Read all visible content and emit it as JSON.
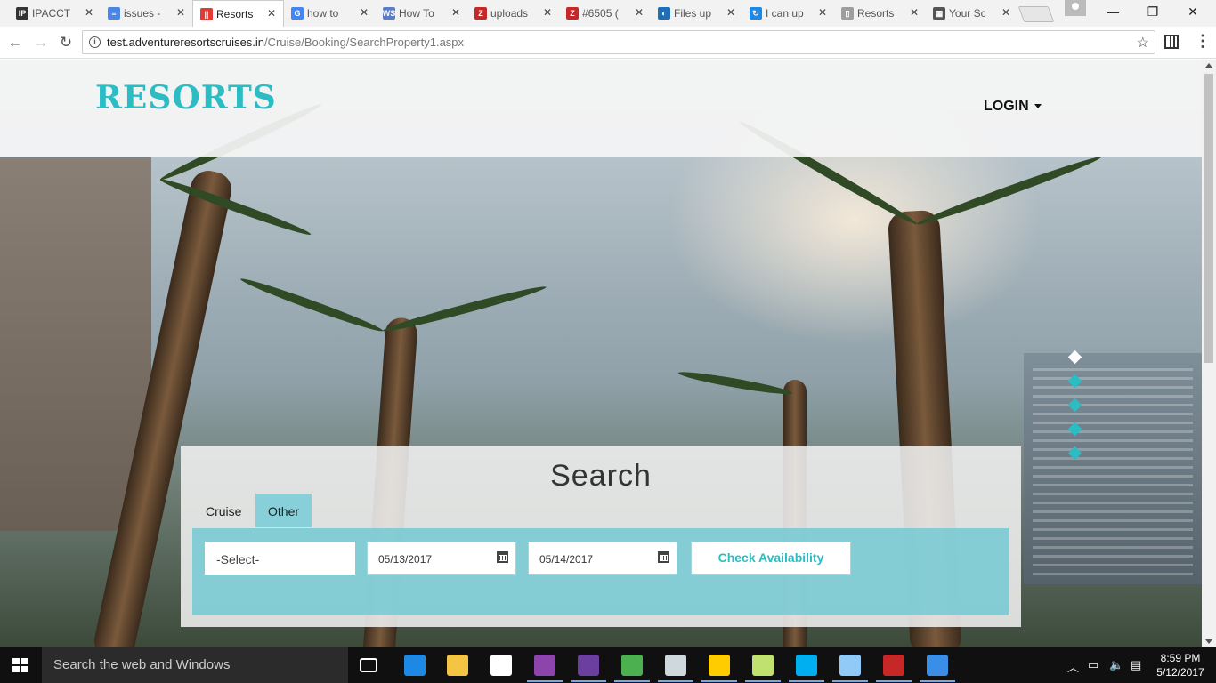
{
  "browser": {
    "tabs": [
      {
        "label": "IPACCT",
        "favicon": "IP",
        "color": "#333333",
        "active": false
      },
      {
        "label": "issues -",
        "favicon": "≡",
        "color": "#4a86e8",
        "active": false
      },
      {
        "label": "Resorts",
        "favicon": "||",
        "color": "#e53935",
        "active": true
      },
      {
        "label": "how to",
        "favicon": "G",
        "color": "#4285f4",
        "active": false
      },
      {
        "label": "How To",
        "favicon": "WS",
        "color": "#5a7dc8",
        "active": false
      },
      {
        "label": "uploads",
        "favicon": "Z",
        "color": "#c62828",
        "active": false
      },
      {
        "label": "#6505 (",
        "favicon": "Z",
        "color": "#c62828",
        "active": false
      },
      {
        "label": "Files up",
        "favicon": "◐",
        "color": "#1e6fb5",
        "active": false
      },
      {
        "label": "I can up",
        "favicon": "↻",
        "color": "#1e88e5",
        "active": false
      },
      {
        "label": "Resorts",
        "favicon": "▯",
        "color": "#9e9e9e",
        "active": false
      },
      {
        "label": "Your Sc",
        "favicon": "▦",
        "color": "#555555",
        "active": false
      }
    ],
    "url_host": "test.adventureresortscruises.in",
    "url_path": "/Cruise/Booking/SearchProperty1.aspx",
    "close_glyph": "✕",
    "window_minimize": "—",
    "window_restore": "❐",
    "window_close": "✕",
    "back_glyph": "←",
    "forward_glyph": "→",
    "reload_glyph": "↻",
    "star_glyph": "☆",
    "menu_glyph": "⋮"
  },
  "site": {
    "logo": "RESORTS",
    "login_label": "LOGIN",
    "accent_color": "#2bbcc4",
    "slider_dots": 5,
    "slider_active_index": 0
  },
  "search": {
    "title": "Search",
    "tabs": {
      "cruise": "Cruise",
      "other": "Other"
    },
    "select_value": "-Select-",
    "checkin": "05/13/2017",
    "checkout": "05/14/2017",
    "check_button": "Check Availability"
  },
  "taskbar": {
    "search_placeholder": "Search the web and Windows",
    "time": "8:59 PM",
    "date": "5/12/2017",
    "apps": [
      {
        "name": "task-view-icon",
        "color": "#ffffff"
      },
      {
        "name": "edge-icon",
        "color": "#1e88e5"
      },
      {
        "name": "file-explorer-icon",
        "color": "#f4c542"
      },
      {
        "name": "store-icon",
        "color": "#ffffff"
      },
      {
        "name": "visual-studio-icon",
        "color": "#8e44ad"
      },
      {
        "name": "visual-studio-alt-icon",
        "color": "#6a3fa0"
      },
      {
        "name": "chrome-icon",
        "color": "#4caf50"
      },
      {
        "name": "settings-gear-icon",
        "color": "#cfd8dc"
      },
      {
        "name": "tools-icon",
        "color": "#ffcc00"
      },
      {
        "name": "folder-network-icon",
        "color": "#c0e070"
      },
      {
        "name": "skype-icon",
        "color": "#00aff0"
      },
      {
        "name": "paint-icon",
        "color": "#90caf9"
      },
      {
        "name": "filezilla-icon",
        "color": "#c62828"
      },
      {
        "name": "snipping-icon",
        "color": "#3a8ee6"
      }
    ]
  }
}
